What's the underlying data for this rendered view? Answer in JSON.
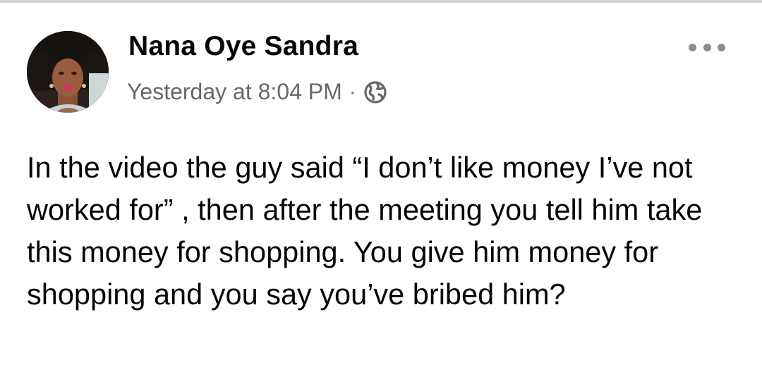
{
  "post": {
    "author": "Nana Oye Sandra",
    "timestamp": "Yesterday at 8:04 PM",
    "separator": "·",
    "privacy_icon": "globe-icon",
    "more_icon": "more-options-icon",
    "text": "In the video the guy said “I don’t like money I’ve not worked for” , then after the meeting you tell him take this money for shopping. You give him money for shopping and you say you’ve bribed him?"
  },
  "colors": {
    "name": "#050505",
    "meta": "#65676b",
    "dots": "#8a8d91",
    "top_border": "#d0d3d8"
  }
}
